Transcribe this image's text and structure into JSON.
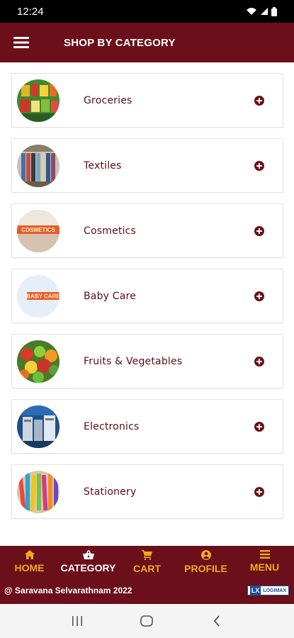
{
  "status_bar": {
    "time": "12:24"
  },
  "app_bar": {
    "title": "SHOP BY CATEGORY",
    "menu_icon": "hamburger-icon"
  },
  "categories": [
    {
      "label": "Groceries",
      "image": "groceries-thumbnail"
    },
    {
      "label": "Textiles",
      "image": "textiles-thumbnail"
    },
    {
      "label": "Cosmetics",
      "image": "cosmetics-thumbnail",
      "image_text": "COSMETICS"
    },
    {
      "label": "Baby Care",
      "image": "baby-care-thumbnail",
      "image_text": "BABY CARE"
    },
    {
      "label": "Fruits & Vegetables",
      "image": "fruits-vegetables-thumbnail"
    },
    {
      "label": "Electronics",
      "image": "electronics-thumbnail"
    },
    {
      "label": "Stationery",
      "image": "stationery-thumbnail"
    }
  ],
  "bottom_nav": {
    "items": [
      {
        "label": "HOME",
        "icon": "home-icon"
      },
      {
        "label": "CATEGORY",
        "icon": "basket-icon",
        "active": true
      },
      {
        "label": "CART",
        "icon": "cart-icon"
      },
      {
        "label": "PROFILE",
        "icon": "profile-icon"
      },
      {
        "label": "MENU",
        "icon": "menu-icon"
      }
    ],
    "footer_text": "@ Saravana Selvarathnam 2022",
    "logo_text": "LX",
    "logo_subtext": "LOGIMAX"
  },
  "colors": {
    "primary": "#6b0f1a",
    "nav_accent": "#f2a91c",
    "label": "#5c0d15"
  }
}
